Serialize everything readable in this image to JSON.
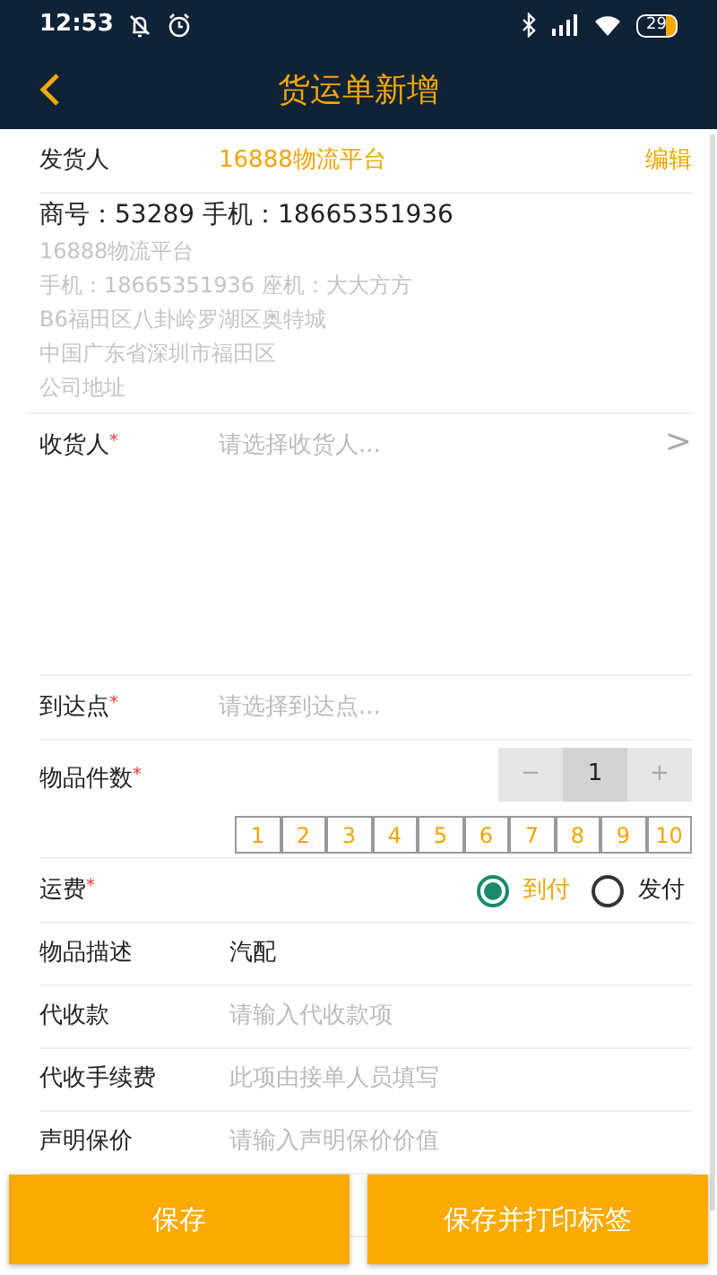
{
  "status_bar": {
    "time": "12:53",
    "battery": "29"
  },
  "header": {
    "title": "货运单新增"
  },
  "sender": {
    "label": "发货人",
    "name": "16888物流平台",
    "action": "编辑",
    "lines": [
      {
        "text": "商号：53289 手机：18665351936",
        "kind": "main"
      },
      {
        "text": "16888物流平台",
        "kind": "sub"
      },
      {
        "text": "手机：18665351936 座机：大大方方",
        "kind": "sub"
      },
      {
        "text": "B6福田区八卦岭罗湖区奥特城",
        "kind": "sub"
      },
      {
        "text": "中国广东省深圳市福田区",
        "kind": "sub"
      },
      {
        "text": "公司地址",
        "kind": "sub"
      }
    ]
  },
  "fields": [
    {
      "kind": "picker",
      "label": "收货人",
      "mark": "*",
      "placeholder": "请选择收货人...",
      "arrow": ">",
      "tall": true
    },
    {
      "kind": "picker",
      "label": "到达点",
      "mark": "*",
      "placeholder": "请选择到达点..."
    },
    {
      "kind": "stepper",
      "label": "物品件数",
      "mark": "*",
      "minus": "−",
      "value": "1",
      "plus": "+",
      "chips": [
        "1",
        "2",
        "3",
        "4",
        "5",
        "6",
        "7",
        "8",
        "9",
        "10"
      ]
    },
    {
      "kind": "radio",
      "label": "运费",
      "mark": "*",
      "options": [
        {
          "label": "到付",
          "selected": true
        },
        {
          "label": "发付",
          "selected": false
        }
      ]
    },
    {
      "kind": "input",
      "label": "物品描述",
      "value": "汽配"
    },
    {
      "kind": "input",
      "label": "代收款",
      "placeholder": "请输入代收款项"
    },
    {
      "kind": "input",
      "label": "代收手续费",
      "placeholder": "此项由接单人员填写"
    },
    {
      "kind": "input",
      "label": "声明保价",
      "placeholder": "请输入声明保价价值"
    }
  ],
  "buttons": [
    {
      "label": "保存"
    },
    {
      "label": "保存并打印标签"
    }
  ]
}
